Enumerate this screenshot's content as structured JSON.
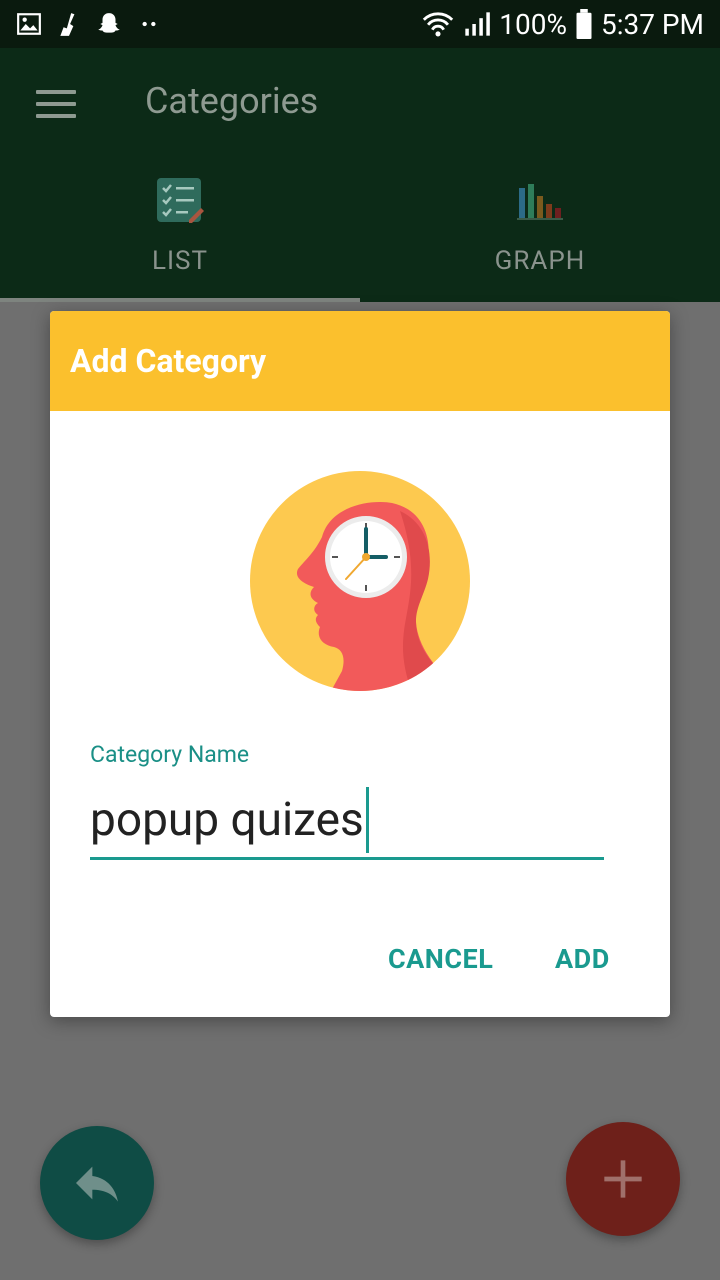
{
  "status_bar": {
    "battery": "100%",
    "time": "5:37 PM",
    "icons": [
      "gallery-icon",
      "cleaner-icon",
      "snapchat-icon",
      "more-dots-icon",
      "wifi-icon",
      "signal-icon",
      "battery-icon"
    ]
  },
  "app_bar": {
    "title": "Categories",
    "menu_icon": "hamburger-menu-icon"
  },
  "tabs": [
    {
      "label": "LIST",
      "icon": "checklist-icon",
      "selected": true
    },
    {
      "label": "GRAPH",
      "icon": "bar-chart-icon",
      "selected": false
    }
  ],
  "dialog": {
    "title": "Add Category",
    "illustration": "head-clock-icon",
    "field_label": "Category Name",
    "field_value": "popup quizes",
    "cancel_label": "CANCEL",
    "add_label": "ADD"
  },
  "fabs": {
    "back_icon": "reply-arrow-icon",
    "add_icon": "plus-icon"
  },
  "colors": {
    "dialog_header": "#fbc02d",
    "accent": "#1a9a8f",
    "app_bar": "#0c2a17",
    "scrim": "#6f6f6f",
    "fab_back": "#0f4c45",
    "fab_add": "#6e201a"
  }
}
